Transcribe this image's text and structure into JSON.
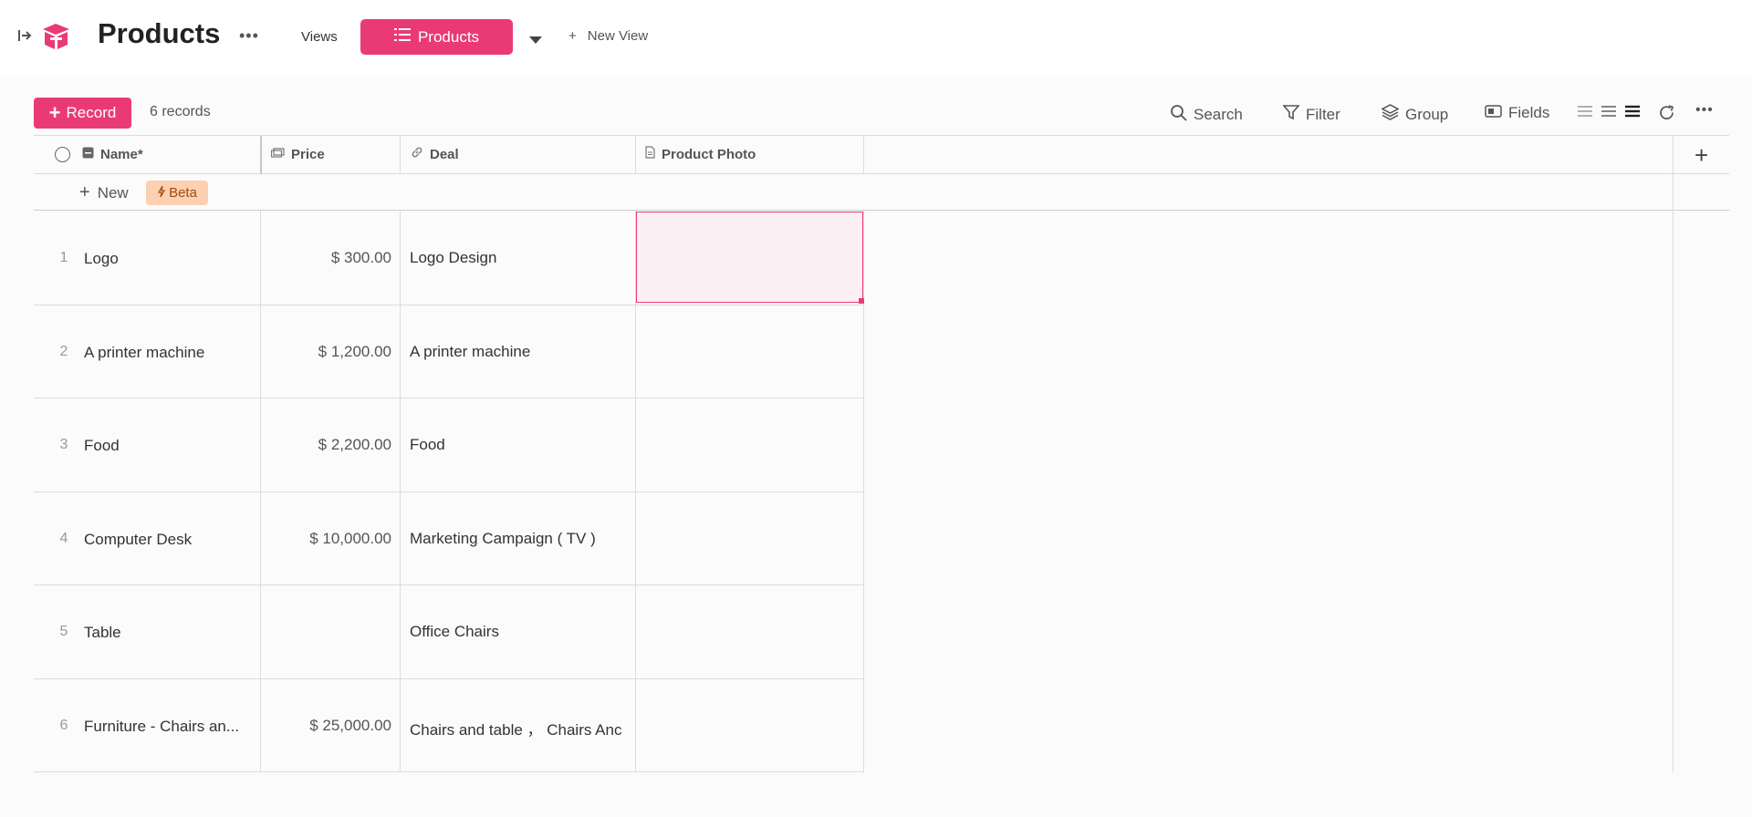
{
  "header": {
    "title": "Products",
    "views_label": "Views",
    "active_view": "Products",
    "new_view_label": "New View"
  },
  "toolbar": {
    "record_button": "Record",
    "record_count": "6 records",
    "search": "Search",
    "filter": "Filter",
    "group": "Group",
    "fields": "Fields"
  },
  "table": {
    "columns": [
      {
        "label": "Name*",
        "icon": "text-field-icon"
      },
      {
        "label": "Price",
        "icon": "currency-field-icon"
      },
      {
        "label": "Deal",
        "icon": "link-field-icon"
      },
      {
        "label": "Product Photo",
        "icon": "file-field-icon"
      }
    ],
    "new_label": "New",
    "beta_label": "Beta",
    "rows": [
      {
        "num": "1",
        "name": "Logo",
        "price": "$ 300.00",
        "deal": "Logo Design",
        "photo": ""
      },
      {
        "num": "2",
        "name": "A printer machine",
        "price": "$ 1,200.00",
        "deal": "A printer machine",
        "photo": ""
      },
      {
        "num": "3",
        "name": "Food",
        "price": "$ 2,200.00",
        "deal": "Food",
        "photo": ""
      },
      {
        "num": "4",
        "name": "Computer Desk",
        "price": "$ 10,000.00",
        "deal": "Marketing Campaign ( TV )",
        "photo": ""
      },
      {
        "num": "5",
        "name": "Table",
        "price": "",
        "deal": "Office Chairs",
        "photo": ""
      },
      {
        "num": "6",
        "name": "Furniture - Chairs an...",
        "price": "$ 25,000.00",
        "deal": "Chairs and table ， Chairs Anc",
        "photo": ""
      }
    ]
  },
  "colors": {
    "accent": "#ea3a76",
    "beta_bg": "#fcd0b0",
    "beta_text": "#a4490f",
    "gridline": "#dcdcdc"
  }
}
